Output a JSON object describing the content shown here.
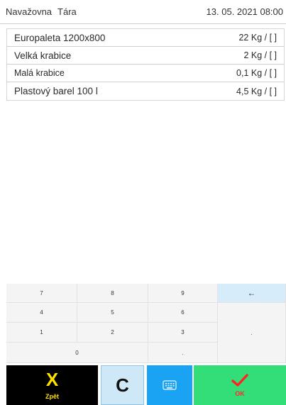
{
  "header": {
    "app": "Navažovna",
    "screen": "Tára",
    "datetime": "13. 05. 2021 08:00"
  },
  "tares": [
    {
      "name": "Europaleta 1200x800",
      "value": "22 Kg / [   ]"
    },
    {
      "name": "Velká krabice",
      "value": "2 Kg / [   ]"
    },
    {
      "name": "Malá krabice",
      "value": "0,1 Kg / [   ]"
    },
    {
      "name": "Plastový barel 100 l",
      "value": "4,5 Kg / [   ]"
    }
  ],
  "keypad": {
    "k7": "7",
    "k8": "8",
    "k9": "9",
    "backspace": "←",
    "k4": "4",
    "k5": "5",
    "k6": "6",
    "k1": "1",
    "k2": "2",
    "k3": "3",
    "dot_right": ".",
    "k0": "0",
    "dot": "."
  },
  "actions": {
    "back_icon": "X",
    "back_label": "Zpět",
    "refresh_icon": "C",
    "ok_label": "OK"
  },
  "colors": {
    "back_bg": "#000000",
    "back_fg": "#ffe000",
    "refresh_bg": "#cfe8f7",
    "keyboard_bg": "#1aa3f2",
    "ok_bg": "#33dd77",
    "ok_check": "#ff2222"
  }
}
